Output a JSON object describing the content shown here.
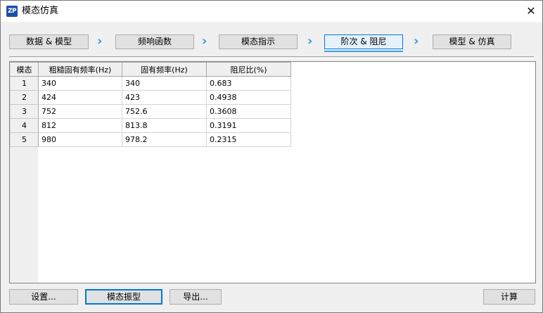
{
  "window": {
    "icon_text": "ZP",
    "title": "模态仿真",
    "close_glyph": "✕"
  },
  "steps": [
    {
      "label": "数据 & 模型",
      "active": false
    },
    {
      "label": "频响函数",
      "active": false
    },
    {
      "label": "模态指示",
      "active": false
    },
    {
      "label": "阶次 & 阻尼",
      "active": true
    },
    {
      "label": "模型 & 仿真",
      "active": false
    }
  ],
  "step_arrow_glyph": "›",
  "accent_color": "#2e9be0",
  "table": {
    "columns": [
      "模态",
      "粗糙固有频率(Hz)",
      "固有频率(Hz)",
      "阻尼比(%)"
    ],
    "rows": [
      {
        "mode": "1",
        "rough_freq": "340",
        "freq": "340",
        "damping": "0.683"
      },
      {
        "mode": "2",
        "rough_freq": "424",
        "freq": "423",
        "damping": "0.4938"
      },
      {
        "mode": "3",
        "rough_freq": "752",
        "freq": "752.6",
        "damping": "0.3608"
      },
      {
        "mode": "4",
        "rough_freq": "812",
        "freq": "813.8",
        "damping": "0.3191"
      },
      {
        "mode": "5",
        "rough_freq": "980",
        "freq": "978.2",
        "damping": "0.2315"
      }
    ]
  },
  "buttons": {
    "settings": "设置...",
    "mode_shape": "模态振型",
    "export": "导出...",
    "compute": "计算"
  }
}
